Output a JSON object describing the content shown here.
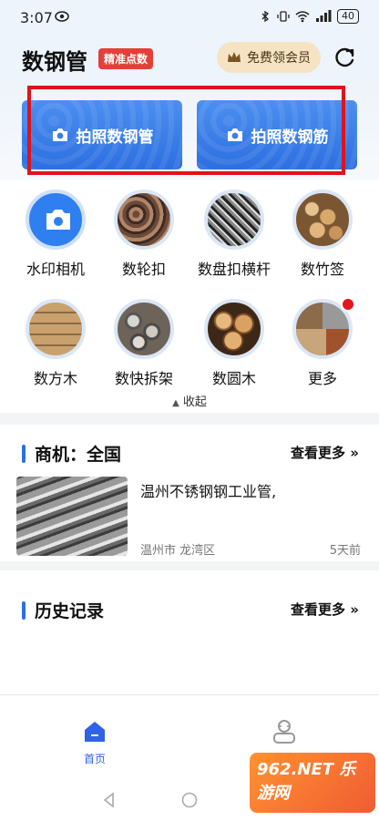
{
  "status_bar": {
    "time": "3:07",
    "battery": "40"
  },
  "header": {
    "title": "数钢管",
    "badge": "精准点数",
    "vip_button": "免费领会员"
  },
  "banners": [
    {
      "label": "拍照数钢管"
    },
    {
      "label": "拍照数钢筋"
    }
  ],
  "tools": [
    {
      "label": "水印相机"
    },
    {
      "label": "数轮扣"
    },
    {
      "label": "数盘扣横杆"
    },
    {
      "label": "数竹签"
    },
    {
      "label": "数方木"
    },
    {
      "label": "数快拆架"
    },
    {
      "label": "数圆木"
    },
    {
      "label": "更多"
    }
  ],
  "collapse_label": "收起",
  "business": {
    "title": "商机：全国",
    "more": "查看更多",
    "item": {
      "title": "温州不锈钢钢工业管,",
      "location": "温州市 龙湾区",
      "time": "5天前"
    }
  },
  "history": {
    "title": "历史记录",
    "more": "查看更多"
  },
  "tabbar": {
    "home": "首页",
    "mine": "我的"
  },
  "watermark": "962.NET 乐游网",
  "colors": {
    "accent": "#2d6fe0",
    "badge": "#e3403a",
    "vip_bg": "#f5e3c4",
    "highlight": "#e0121a"
  }
}
